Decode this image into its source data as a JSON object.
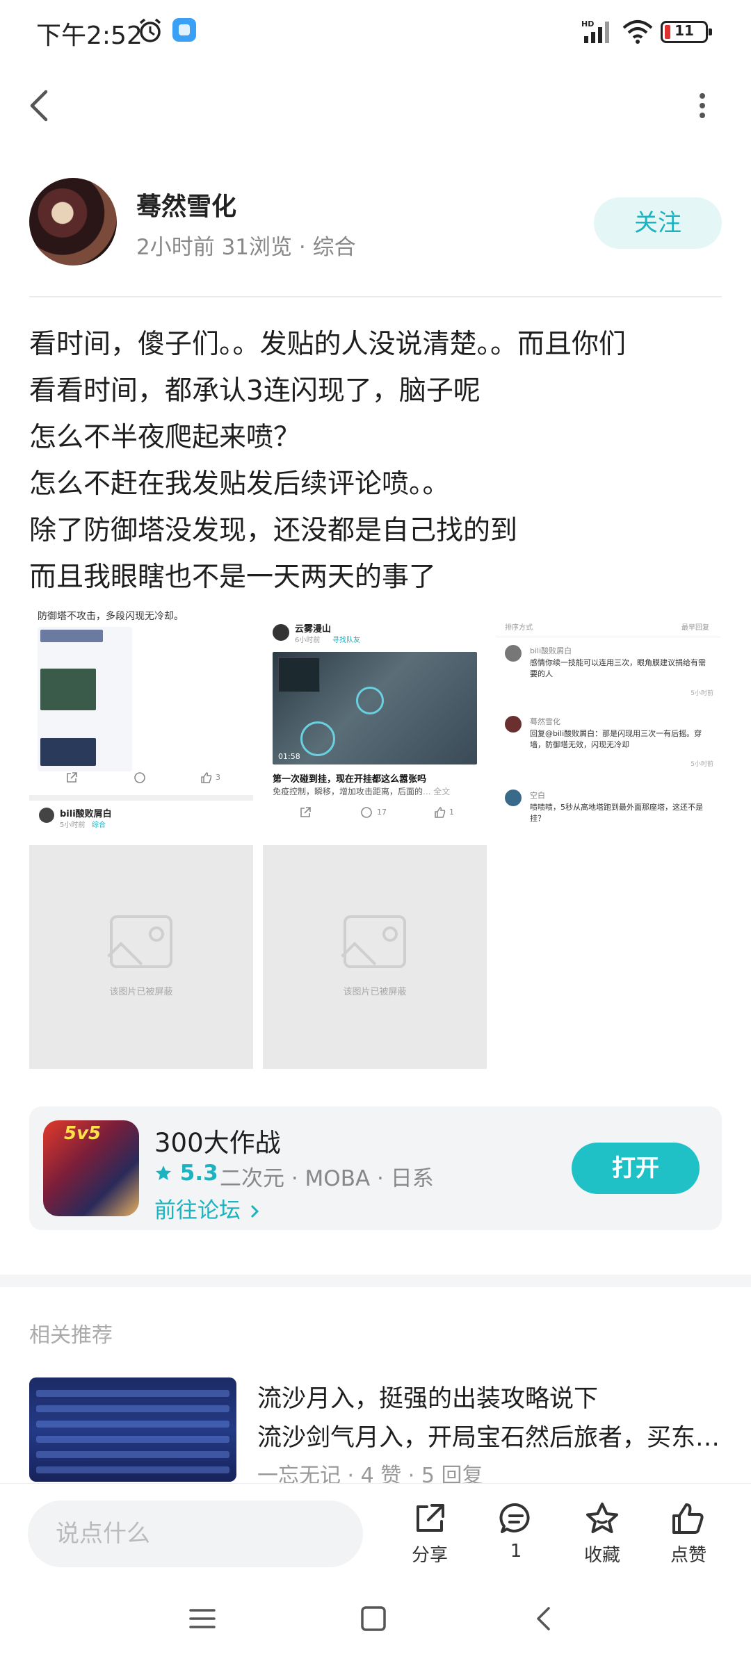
{
  "status_bar": {
    "time": "下午2:52",
    "battery": "11"
  },
  "author": {
    "name": "蓦然雪化",
    "meta": "2小时前  31浏览  ·  综合",
    "follow_label": "关注"
  },
  "post": {
    "lines": [
      "看时间，傻子们。。发贴的人没说清楚。。而且你们",
      "看看时间，都承认3连闪现了，脑子呢",
      "怎么不半夜爬起来喷？",
      "怎么不赶在我发贴发后续评论喷。。",
      "除了防御塔没发现，还没都是自己找的到",
      "而且我眼瞎也不是一天两天的事了"
    ]
  },
  "images": {
    "img1": {
      "header": "防御塔不攻击，多段闪现无冷却。",
      "likes": "3",
      "user": "bili酸败屑白",
      "time": "5小时前",
      "tag": "综合"
    },
    "img2": {
      "user": "云雾漫山",
      "time": "6小时前",
      "tag": "寻找队友",
      "video_time": "01:58",
      "title": "第一次碰到挂，现在开挂都这么嚣张吗",
      "desc": "免疫控制，瞬移，增加攻击距离，后面的",
      "more": "... 全文",
      "comments": "17",
      "likes": "1"
    },
    "img3": {
      "sort_label": "排序方式",
      "sort_value": "最早回复",
      "comments": [
        {
          "user": "bili酸败屑白",
          "text": "感情你续一技能可以连用三次，眼角膜建议捐给有需要的人",
          "time": "5小时前"
        },
        {
          "user": "蓦然雪化",
          "text": "回复@bili酸败屑白：那是闪现用三次一有后摇。穿墙，防御塔无效，闪现无冷却",
          "time": "5小时前"
        },
        {
          "user": "空白",
          "text": "啧啧啧，5秒从高地塔跑到最外面那座塔，这还不是挂？",
          "time": ""
        }
      ]
    },
    "blocked_label": "该图片已被屏蔽"
  },
  "game": {
    "icon_text": "5v5",
    "name": "300大作战",
    "rating": "5.3",
    "tags": "二次元 · MOBA · 日系",
    "forum_link": "前往论坛",
    "open_label": "打开"
  },
  "related": {
    "title": "相关推荐",
    "item": {
      "line1": "流沙月入，挺强的出装攻略说下",
      "line2": "流沙剑气月入，开局宝石然后旅者，买东西的顺序",
      "meta": "一忘无记  ·  4 赞  ·  5 回复"
    }
  },
  "bottom_bar": {
    "input_placeholder": "说点什么",
    "share": "分享",
    "comment_count": "1",
    "collect": "收藏",
    "like": "点赞"
  },
  "colors": {
    "accent": "#1fc0c6",
    "follow_bg": "#e4f6f6"
  }
}
